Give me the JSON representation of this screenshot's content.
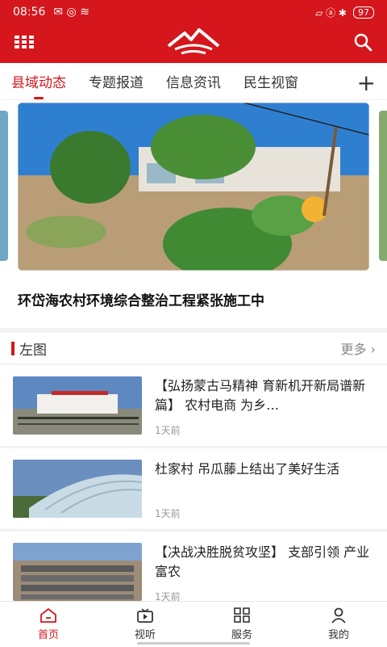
{
  "status": {
    "time": "08:56",
    "battery": "97"
  },
  "header": {
    "logo_icon": "mountain-logo",
    "menu_icon": "grid-menu-icon",
    "search_icon": "search-icon"
  },
  "tabs": [
    {
      "label": "县域动态",
      "active": true
    },
    {
      "label": "专题报道"
    },
    {
      "label": "信息资讯"
    },
    {
      "label": "民生视窗"
    }
  ],
  "hero": {
    "title": "环岱海农村环境综合整治工程紧张施工中"
  },
  "section": {
    "title": "左图",
    "more": "更多"
  },
  "news": [
    {
      "title": "【弘扬蒙古马精神 育新机开新局谱新篇】 农村电商 为乡…",
      "time": "1天前"
    },
    {
      "title": "杜家村 吊瓜藤上结出了美好生活",
      "time": "1天前"
    },
    {
      "title": "【决战决胜脱贫攻坚】 支部引领 产业富农",
      "time": "1天前"
    }
  ],
  "nav": [
    {
      "label": "首页",
      "icon": "home-icon",
      "active": true
    },
    {
      "label": "视听",
      "icon": "video-icon"
    },
    {
      "label": "服务",
      "icon": "grid-icon"
    },
    {
      "label": "我的",
      "icon": "user-icon"
    }
  ]
}
